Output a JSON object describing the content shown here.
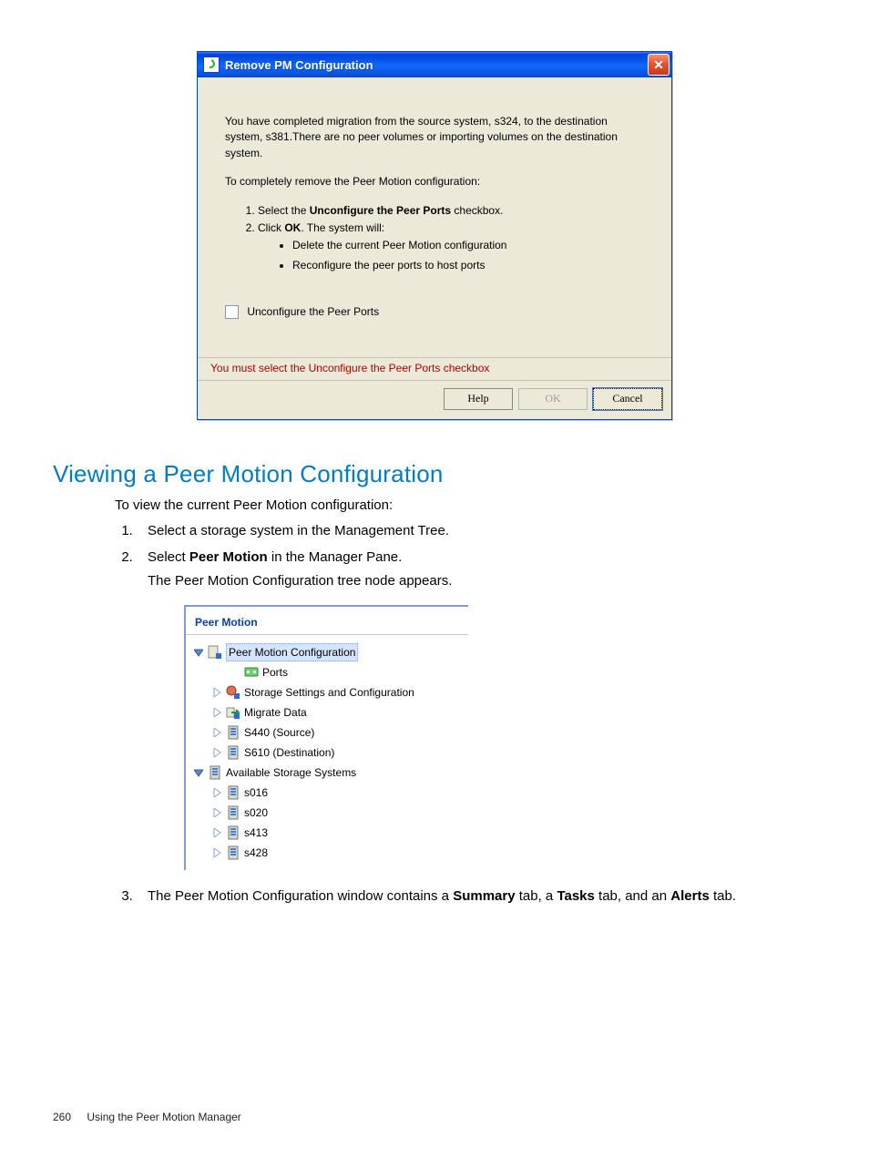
{
  "dialog": {
    "title": "Remove PM Configuration",
    "para1": "You have completed migration from the source system, s324, to the destination system, s381.There are no peer volumes or importing volumes on the destination system.",
    "para2": "To completely remove the Peer Motion configuration:",
    "step1_pre": "Select the ",
    "step1_bold": "Unconfigure the Peer Ports",
    "step1_post": " checkbox.",
    "step2_pre": "Click ",
    "step2_bold": "OK",
    "step2_post": ". The system will:",
    "bullet1": "Delete the current Peer Motion configuration",
    "bullet2": "Reconfigure the peer ports to host ports",
    "checkbox_label": "Unconfigure the Peer Ports",
    "error": "You must select the Unconfigure the Peer Ports checkbox",
    "help": "Help",
    "ok": "OK",
    "cancel": "Cancel",
    "close_glyph": "✕"
  },
  "section": {
    "heading": "Viewing a Peer Motion Configuration",
    "intro": "To view the current Peer Motion configuration:",
    "s1": "Select a storage system in the Management Tree.",
    "s2_pre": "Select ",
    "s2_bold": "Peer Motion",
    "s2_post": " in the Manager Pane.",
    "s2_sub": "The Peer Motion Configuration tree node appears.",
    "s3_pre": "The Peer Motion Configuration window contains a ",
    "s3_b1": "Summary",
    "s3_mid1": " tab, a ",
    "s3_b2": "Tasks",
    "s3_mid2": " tab, and an ",
    "s3_b3": "Alerts",
    "s3_post": " tab."
  },
  "tree": {
    "header": "Peer Motion",
    "n_root": "Peer Motion Configuration",
    "n_ports": "Ports",
    "n_storage": "Storage Settings and Configuration",
    "n_migrate": "Migrate Data",
    "n_src": "S440 (Source)",
    "n_dst": "S610 (Destination)",
    "n_avail": "Available Storage Systems",
    "n_s016": "s016",
    "n_s020": "s020",
    "n_s413": "s413",
    "n_s428": "s428"
  },
  "footer": {
    "page": "260",
    "chapter": "Using the Peer Motion Manager"
  }
}
